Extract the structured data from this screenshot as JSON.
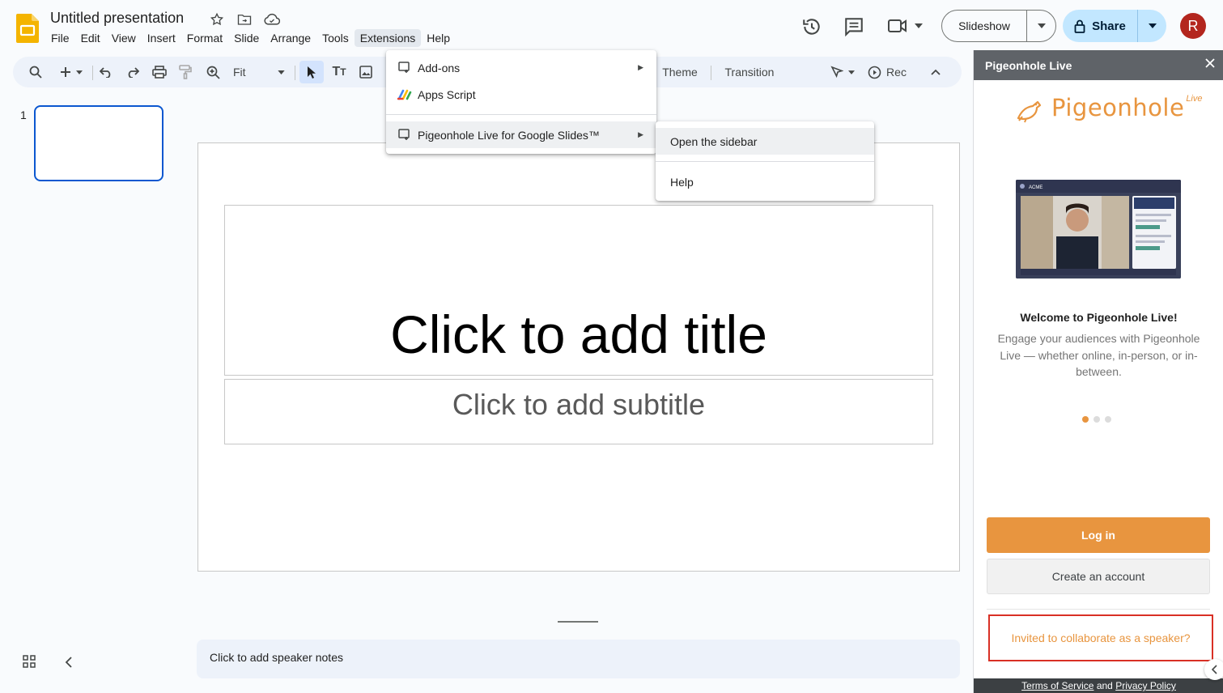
{
  "app": {
    "doc_title": "Untitled presentation",
    "menus": [
      "File",
      "Edit",
      "View",
      "Insert",
      "Format",
      "Slide",
      "Arrange",
      "Tools",
      "Extensions",
      "Help"
    ],
    "active_menu": "Extensions"
  },
  "header": {
    "slideshow_label": "Slideshow",
    "share_label": "Share",
    "avatar_initial": "R"
  },
  "toolbar": {
    "zoom_label": "Fit",
    "theme_label": "Theme",
    "transition_label": "Transition",
    "rec_label": "Rec"
  },
  "slides": {
    "number": "1"
  },
  "slide": {
    "title_placeholder": "Click to add title",
    "subtitle_placeholder": "Click to add subtitle",
    "notes_placeholder": "Click to add speaker notes"
  },
  "extensions_menu": {
    "items": [
      "Add-ons",
      "Apps Script",
      "Pigeonhole Live for Google Slides™"
    ]
  },
  "pigeonhole_submenu": {
    "items": [
      "Open the sidebar",
      "Help"
    ]
  },
  "sidebar": {
    "title": "Pigeonhole Live",
    "logo_word": "Pigeonhole",
    "logo_super": "Live",
    "preview_brand": "ACME",
    "welcome_title": "Welcome to Pigeonhole Live!",
    "welcome_desc": "Engage your audiences with Pigeonhole Live — whether online, in-person, or in-between.",
    "login_label": "Log in",
    "create_label": "Create an account",
    "invite_label": "Invited to collaborate as a speaker?",
    "footer_tos": "Terms of Service",
    "footer_and": "and",
    "footer_pp": "Privacy Policy",
    "accent_color": "#e8953f"
  }
}
